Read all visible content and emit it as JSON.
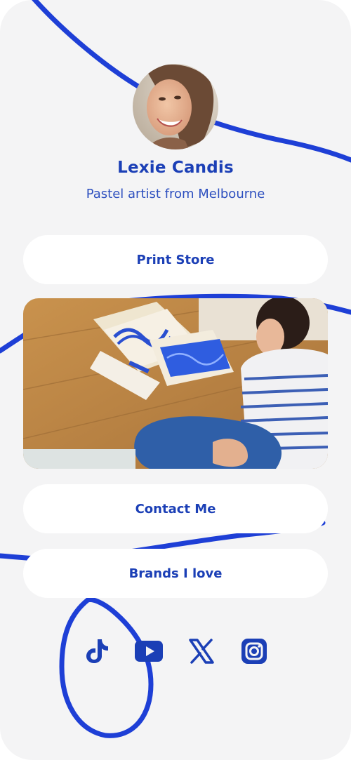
{
  "profile": {
    "name": "Lexie Candis",
    "bio": "Pastel artist from Melbourne"
  },
  "links": {
    "print_store": "Print Store",
    "contact_me": "Contact Me",
    "brands": "Brands I love"
  },
  "social": {
    "icons": [
      "tiktok-icon",
      "youtube-icon",
      "x-icon",
      "instagram-icon"
    ]
  },
  "colors": {
    "accent": "#1b3fb6",
    "scribble": "#1e3fd6",
    "background": "#f4f4f5",
    "button": "#ffffff"
  }
}
